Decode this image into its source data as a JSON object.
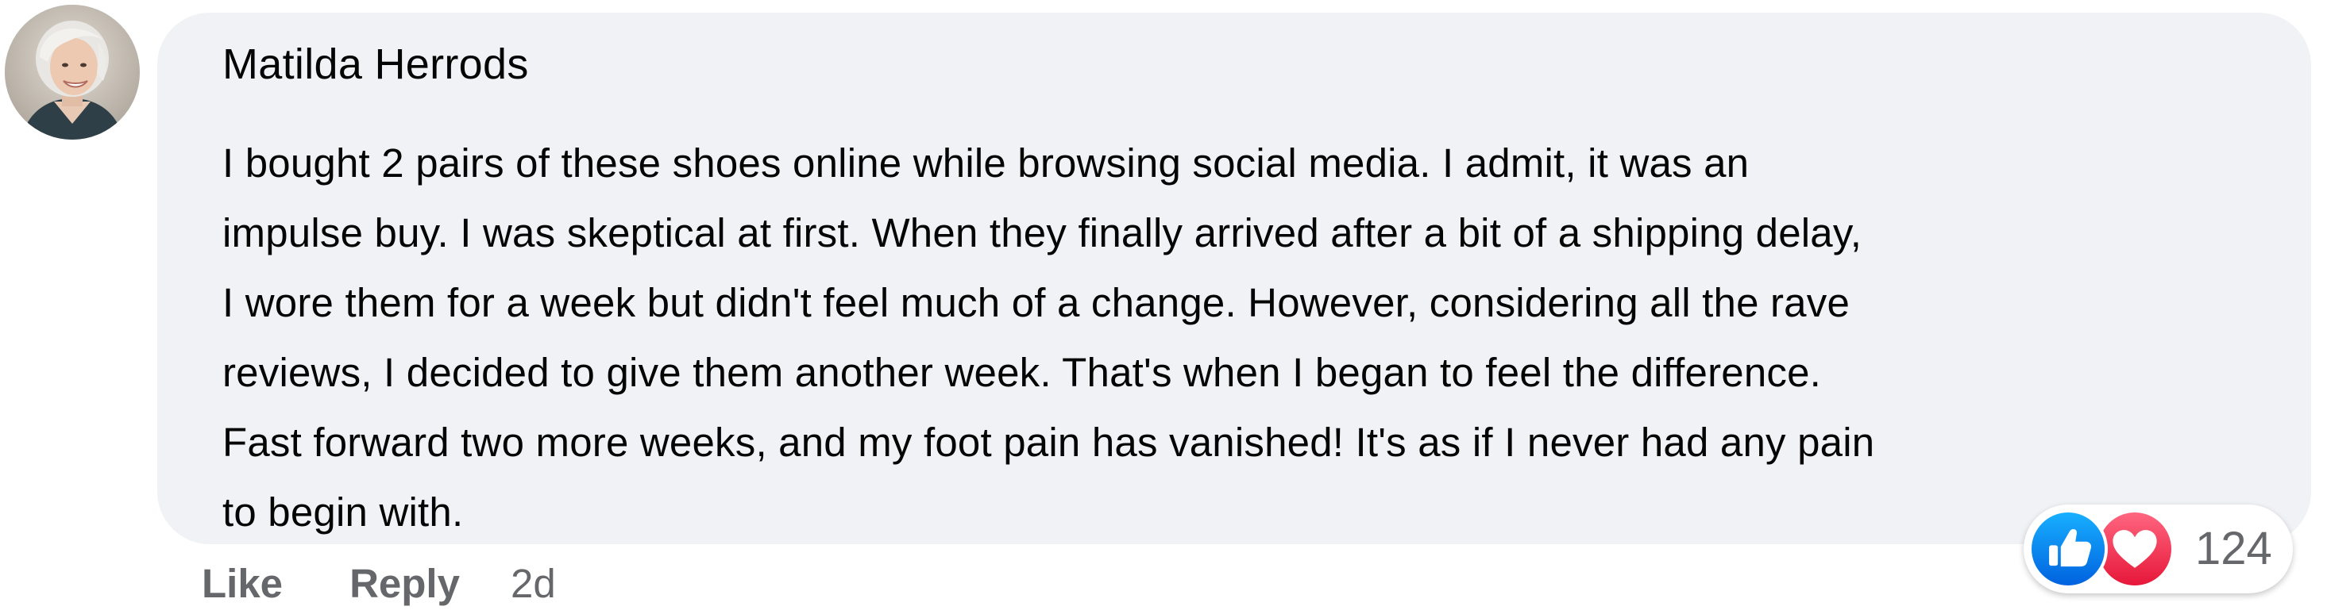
{
  "comment": {
    "author": "Matilda Herrods",
    "text_lines": [
      "I bought 2 pairs of these shoes online while browsing social media. I admit, it was an",
      "impulse buy. I was skeptical at first. When they finally arrived after a bit of a shipping delay,",
      "I wore them for a week but didn't feel much of a change. However, considering all the rave",
      "reviews, I decided to give them another week. That's when I began to feel the difference.",
      "Fast forward two more weeks, and my foot pain has vanished! It's as if I never had any pain",
      "to begin with."
    ]
  },
  "actions": {
    "like_label": "Like",
    "reply_label": "Reply",
    "timestamp": "2d"
  },
  "reactions": {
    "count": "124",
    "icons": [
      "like-icon",
      "love-icon"
    ],
    "like_color": "#1877f2",
    "love_color": "#f33e58"
  },
  "colors": {
    "bubble_background": "#f0f2f5",
    "text": "#050505",
    "secondary_text": "#65676b"
  }
}
